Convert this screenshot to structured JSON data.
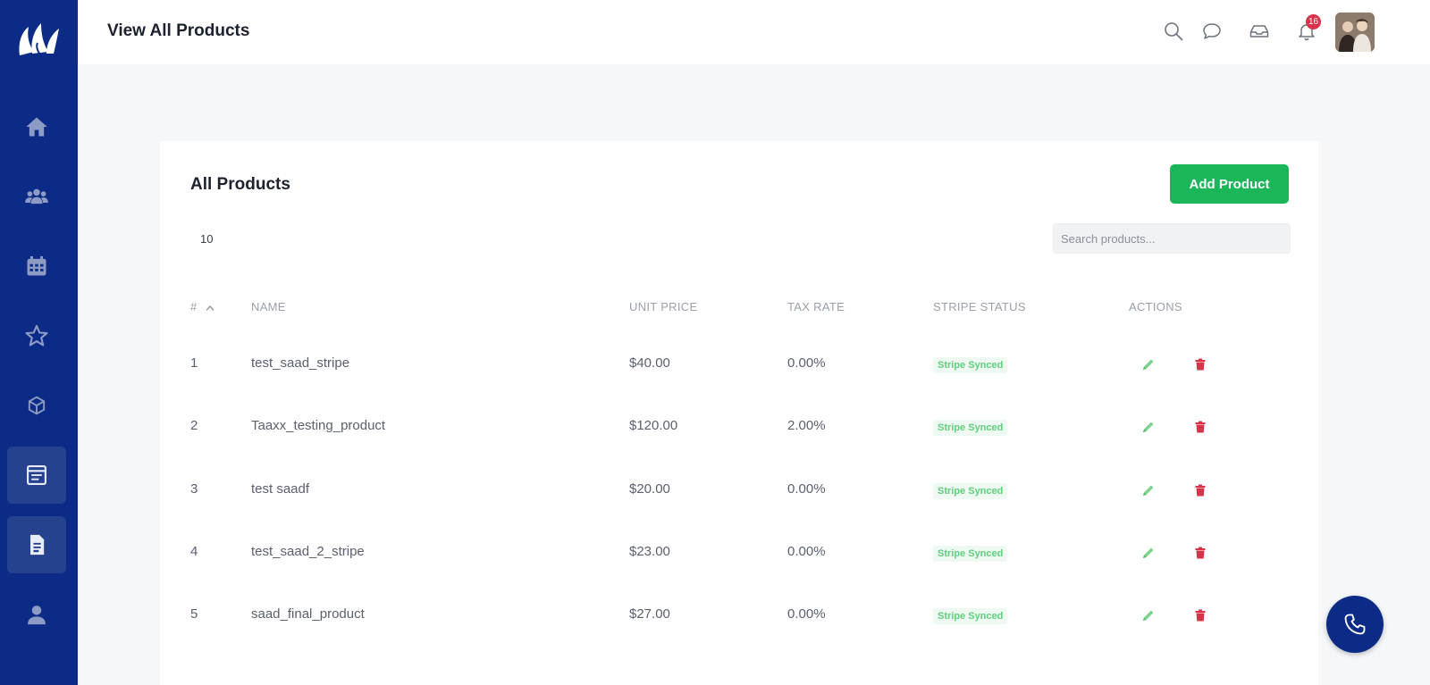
{
  "header": {
    "title": "View All Products",
    "notification_count": "16"
  },
  "sidebar": {
    "items": [
      {
        "icon": "home-icon"
      },
      {
        "icon": "users-icon"
      },
      {
        "icon": "calendar-icon"
      },
      {
        "icon": "star-icon"
      },
      {
        "icon": "box-icon"
      },
      {
        "icon": "invoice-list-icon",
        "active": true
      },
      {
        "icon": "document-icon",
        "active": true
      },
      {
        "icon": "user-icon"
      }
    ]
  },
  "products": {
    "title": "All Products",
    "add_label": "Add Product",
    "page_size": "10",
    "search_placeholder": "Search products...",
    "columns": [
      "#",
      "NAME",
      "UNIT PRICE",
      "TAX RATE",
      "STRIPE STATUS",
      "ACTIONS"
    ],
    "rows": [
      {
        "num": "1",
        "name": "test_saad_stripe",
        "price": "$40.00",
        "tax": "0.00%",
        "status": "Stripe Synced"
      },
      {
        "num": "2",
        "name": "Taaxx_testing_product",
        "price": "$120.00",
        "tax": "2.00%",
        "status": "Stripe Synced"
      },
      {
        "num": "3",
        "name": "test saadf",
        "price": "$20.00",
        "tax": "0.00%",
        "status": "Stripe Synced"
      },
      {
        "num": "4",
        "name": "test_saad_2_stripe",
        "price": "$23.00",
        "tax": "0.00%",
        "status": "Stripe Synced"
      },
      {
        "num": "5",
        "name": "saad_final_product",
        "price": "$27.00",
        "tax": "0.00%",
        "status": "Stripe Synced"
      }
    ]
  },
  "colors": {
    "sidebar": "#0b2b86",
    "accent_green": "#1bb55a",
    "delete_red": "#d9324b"
  }
}
